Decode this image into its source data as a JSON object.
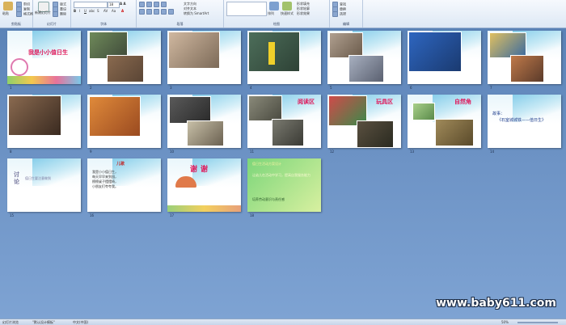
{
  "ribbon": {
    "groups": [
      {
        "label": "剪贴板",
        "buttons": [
          "粘贴",
          "剪切",
          "复制",
          "格式刷"
        ]
      },
      {
        "label": "幻灯片",
        "buttons": [
          "新建幻灯片",
          "版式",
          "重设",
          "删除"
        ]
      },
      {
        "label": "字体",
        "buttons": []
      },
      {
        "label": "段落",
        "buttons": [
          "文字方向",
          "对齐文本",
          "转换为 SmartArt"
        ]
      },
      {
        "label": "绘图",
        "buttons": [
          "形状",
          "排列",
          "快速样式",
          "形状填充",
          "形状轮廓",
          "形状效果"
        ]
      },
      {
        "label": "编辑",
        "buttons": [
          "查找",
          "替换",
          "选择"
        ]
      }
    ],
    "font_size": "18"
  },
  "slides": [
    {
      "num": "1",
      "title": "我是小小值日生"
    },
    {
      "num": "2"
    },
    {
      "num": "3"
    },
    {
      "num": "4"
    },
    {
      "num": "5"
    },
    {
      "num": "6"
    },
    {
      "num": "7"
    },
    {
      "num": "8"
    },
    {
      "num": "9"
    },
    {
      "num": "10"
    },
    {
      "num": "11",
      "title": "阅读区"
    },
    {
      "num": "12",
      "title": "玩具区"
    },
    {
      "num": "13",
      "title": "自然角"
    },
    {
      "num": "14",
      "bullets": [
        "故事：",
        "《石室城城铁——值日生》"
      ]
    },
    {
      "num": "15",
      "title": "讨论",
      "text": "值日生要注意做到"
    },
    {
      "num": "16",
      "title": "儿歌",
      "lines": [
        "我是小小值日生，",
        "每天早早来到园，",
        "擦擦桌子摆摆椅，",
        "小朋友们夸夸我。"
      ]
    },
    {
      "num": "17",
      "title": "谢谢"
    },
    {
      "num": "18",
      "lines": [
        "值日生活动方案设计",
        "让幼儿在活动中学习，提高自我服务能力",
        "培养劳动意识与责任感"
      ]
    }
  ],
  "watermark": "www.baby611.com",
  "status": {
    "view": "幻灯片浏览",
    "theme": "\"默认设计模板\"",
    "language": "中文(中国)",
    "zoom": "50%"
  },
  "colors": {
    "workspace": "#6d93c5",
    "ribbon": "#dde8f5",
    "title_red": "#e0195a"
  }
}
